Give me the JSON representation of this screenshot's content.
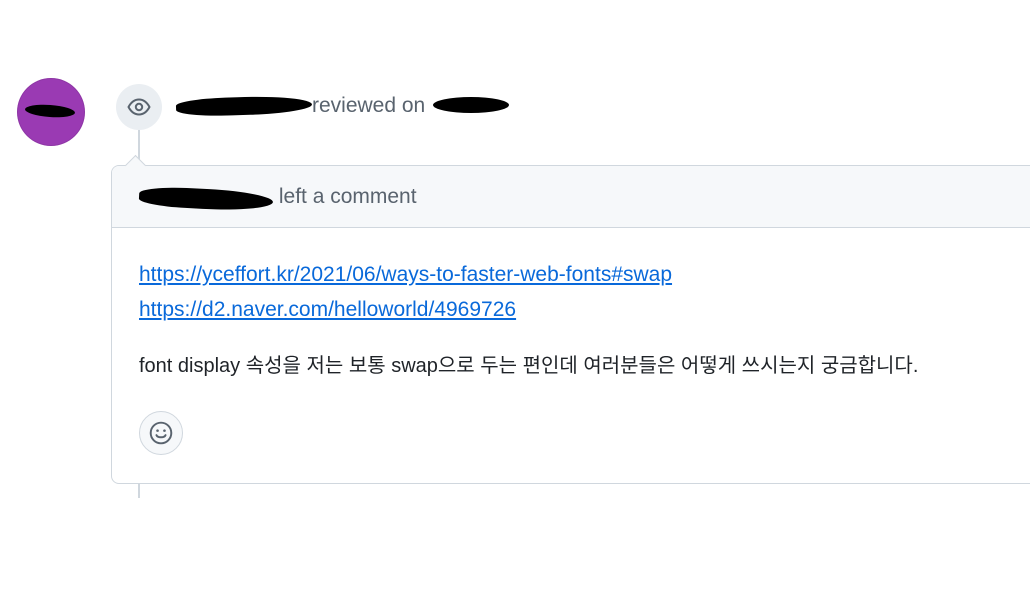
{
  "event": {
    "action_text": "reviewed on",
    "icon": "eye-icon"
  },
  "comment": {
    "header_text": "left a comment",
    "links": [
      "https://yceffort.kr/2021/06/ways-to-faster-web-fonts#swap",
      "https://d2.naver.com/helloworld/4969726"
    ],
    "body_text": "font display 속성을 저는 보통 swap으로 두는 편인데 여러분들은 어떻게 쓰시는지 궁금합니다.",
    "reaction_icon": "smiley-icon"
  },
  "colors": {
    "link": "#0969da",
    "avatar": "#9a3ab3",
    "muted_text": "#59636e",
    "border": "#d0d7de"
  }
}
